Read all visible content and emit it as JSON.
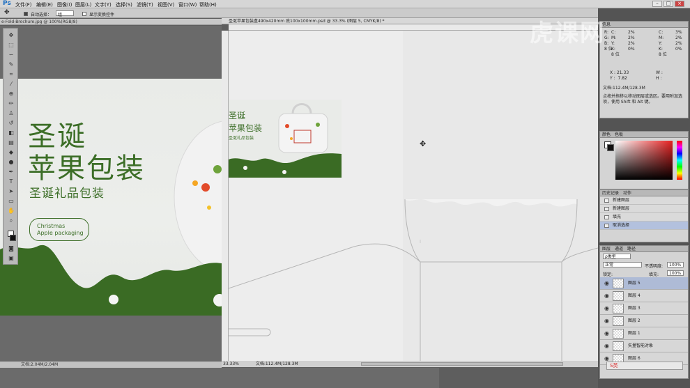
{
  "app": {
    "logo": "Ps"
  },
  "menubar": {
    "items": [
      "文件(F)",
      "编辑(E)",
      "图像(I)",
      "图层(L)",
      "文字(Y)",
      "选择(S)",
      "滤镜(T)",
      "视图(V)",
      "窗口(W)",
      "帮助(H)"
    ]
  },
  "options": {
    "auto_select_label": "自动选择：",
    "auto_select_value": "组",
    "transform_label": "显示变换控件"
  },
  "window_buttons": {
    "minimize": "–",
    "restore": "□",
    "close": "×"
  },
  "doc1": {
    "tab_title": "e-Fold-Brochure.jpg @ 100%(RGB/8)",
    "status": "文档:2.04M/2.04M"
  },
  "banner": {
    "title_line1": "圣诞",
    "title_line2": "苹果包装",
    "subtitle": "圣诞礼品包装",
    "pill_line1": "Christmas",
    "pill_line2": "Apple packaging"
  },
  "doc2": {
    "tab_title": "圣诞苹果包装盒490x420mm 底100x100mm.psd @ 33.3% (图层 5, CMYK/8) *",
    "zoom": "33.33%",
    "status": "文档:112.4M/128.3M"
  },
  "thumb": {
    "line1": "圣诞",
    "line2": "苹果包装",
    "line3": "圣诞礼品包装"
  },
  "info_panel": {
    "tab": "信息",
    "rgb_labels": [
      "R:",
      "G:",
      "B:"
    ],
    "cmyk_labels": [
      "C:",
      "M:",
      "Y:",
      "K:"
    ],
    "cmyk_values": [
      "2%",
      "2%",
      "2%",
      "0%"
    ],
    "cmyk_right_values": [
      "3%",
      "2%",
      "2%",
      "0%"
    ],
    "bits": "8 位",
    "x_label": "X :",
    "x_value": "21.33",
    "y_label": "Y :",
    "y_value": "7.82",
    "w_label": "W :",
    "h_label": "H :",
    "doc": "文档:112.4M/128.3M",
    "hint": "点按并拖移以移动图层或选区。要用附加选项，使用 Shift 和 Alt 键。"
  },
  "color_panel": {
    "tabs": [
      "颜色",
      "色板"
    ]
  },
  "history_panel": {
    "tabs": [
      "历史记录",
      "动作"
    ],
    "items": [
      "新建图层",
      "新建图层",
      "填充",
      "取消选择"
    ],
    "active_index": 3
  },
  "layers_panel": {
    "tabs": [
      "图层",
      "通道",
      "路径"
    ],
    "filter_label": "ρ类型",
    "blend_mode": "正常",
    "opacity_label": "不透明度:",
    "opacity_value": "100%",
    "lock_label": "锁定:",
    "fill_label": "填充:",
    "fill_value": "100%",
    "layers": [
      "图层 5",
      "图层 4",
      "图层 3",
      "图层 2",
      "图层 1",
      "矢量智能对象",
      "图层 6"
    ],
    "active_index": 0
  },
  "watermark": "虎课网",
  "taskbar": {
    "ime_label": "S英"
  }
}
